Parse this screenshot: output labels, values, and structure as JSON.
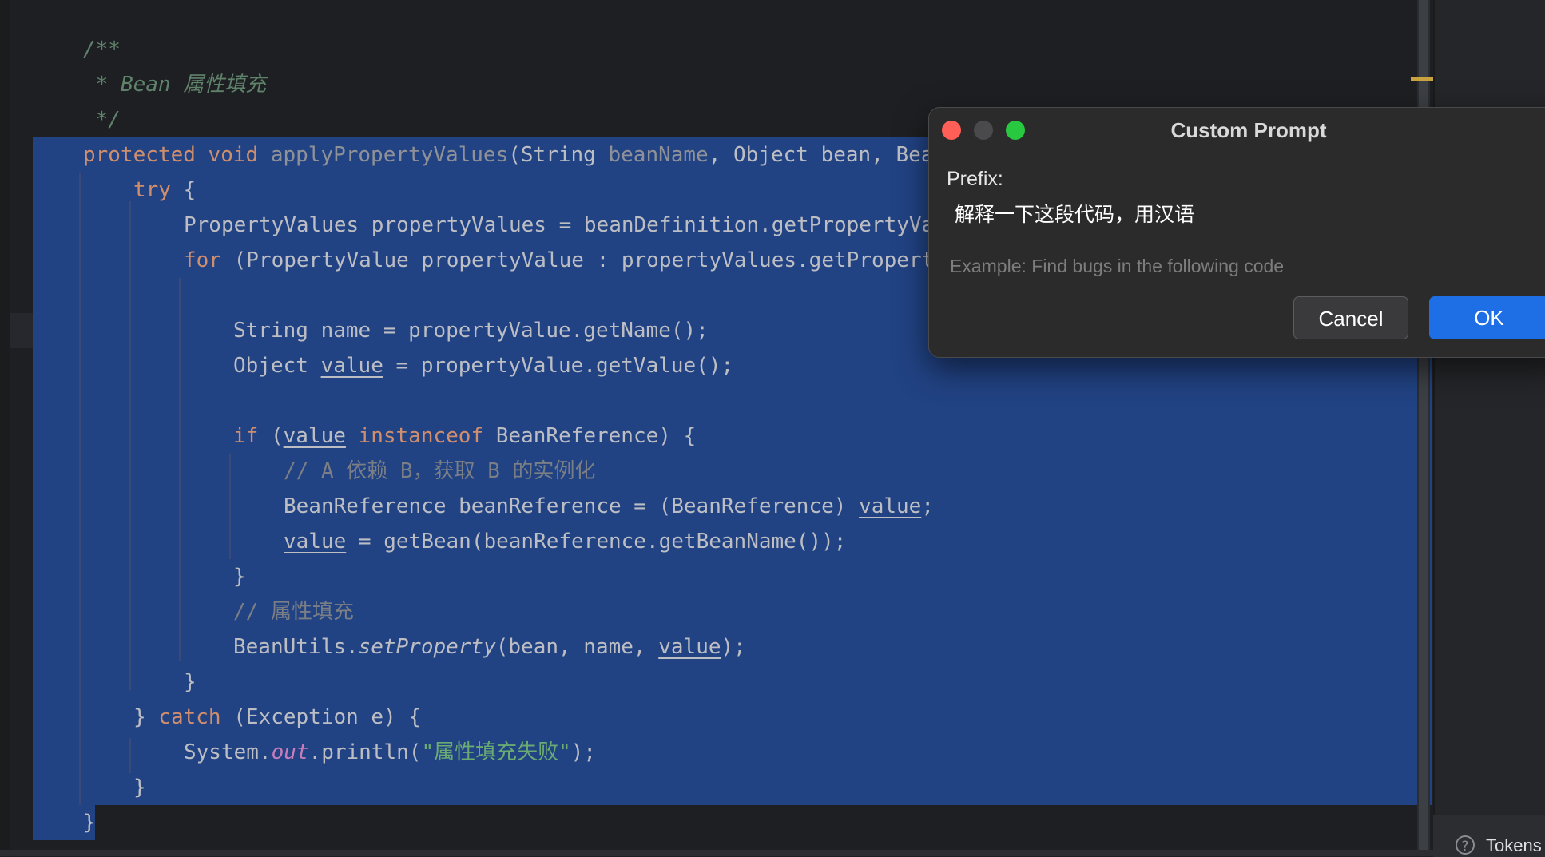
{
  "editor": {
    "lines": {
      "l0": [
        "/**"
      ],
      "l1": [
        " * Bean 属性填充"
      ],
      "l2": [
        " */"
      ],
      "l3": [
        "protected",
        " ",
        "void",
        " ",
        "applyPropertyValues",
        "(String ",
        "beanName",
        ", Object bean, Bea"
      ],
      "l4": [
        "try",
        " {"
      ],
      "l5": [
        "PropertyValues propertyValues = beanDefinition.getPropertyVa"
      ],
      "l6": [
        "for",
        " (PropertyValue propertyValue : propertyValues.getPropert"
      ],
      "l8": [
        "String name = propertyValue.getName();"
      ],
      "l9": [
        "Object ",
        "value",
        " = propertyValue.getValue();"
      ],
      "l11": [
        "if",
        " (",
        "value",
        " ",
        "instanceof",
        " BeanReference) {"
      ],
      "l12": [
        "// A 依赖 B，获取 B 的实例化"
      ],
      "l13": [
        "BeanReference beanReference = (BeanReference) ",
        "value",
        ";"
      ],
      "l14": [
        "value",
        " = getBean(beanReference.getBeanName());"
      ],
      "l15": [
        "}"
      ],
      "l16": [
        "// 属性填充"
      ],
      "l17": [
        "BeanUtils.",
        "setProperty",
        "(bean, name, ",
        "value",
        ");"
      ],
      "l18": [
        "}"
      ],
      "l19": [
        "} ",
        "catch",
        " (Exception e) {"
      ],
      "l20": [
        "System.",
        "out",
        ".println(",
        "\"属性填充失败\"",
        ");"
      ],
      "l21": [
        "}"
      ],
      "l22": [
        "}"
      ]
    }
  },
  "dialog": {
    "title": "Custom Prompt",
    "prefix_label": "Prefix:",
    "prefix_value": "解释一下这段代码，用汉语",
    "placeholder": "Example: Find bugs in the following code",
    "cancel_label": "Cancel",
    "ok_label": "OK"
  },
  "status": {
    "tokens_label": "Tokens",
    "help_glyph": "?"
  },
  "colors": {
    "editor_bg": "#1e1f22",
    "selection": "#214283",
    "keyword": "#cf8e6d",
    "string": "#6aab73",
    "comment": "#7a7e85",
    "doc_comment": "#5f826b",
    "static_field": "#c77dbb",
    "ok_button": "#1e6fe6"
  }
}
